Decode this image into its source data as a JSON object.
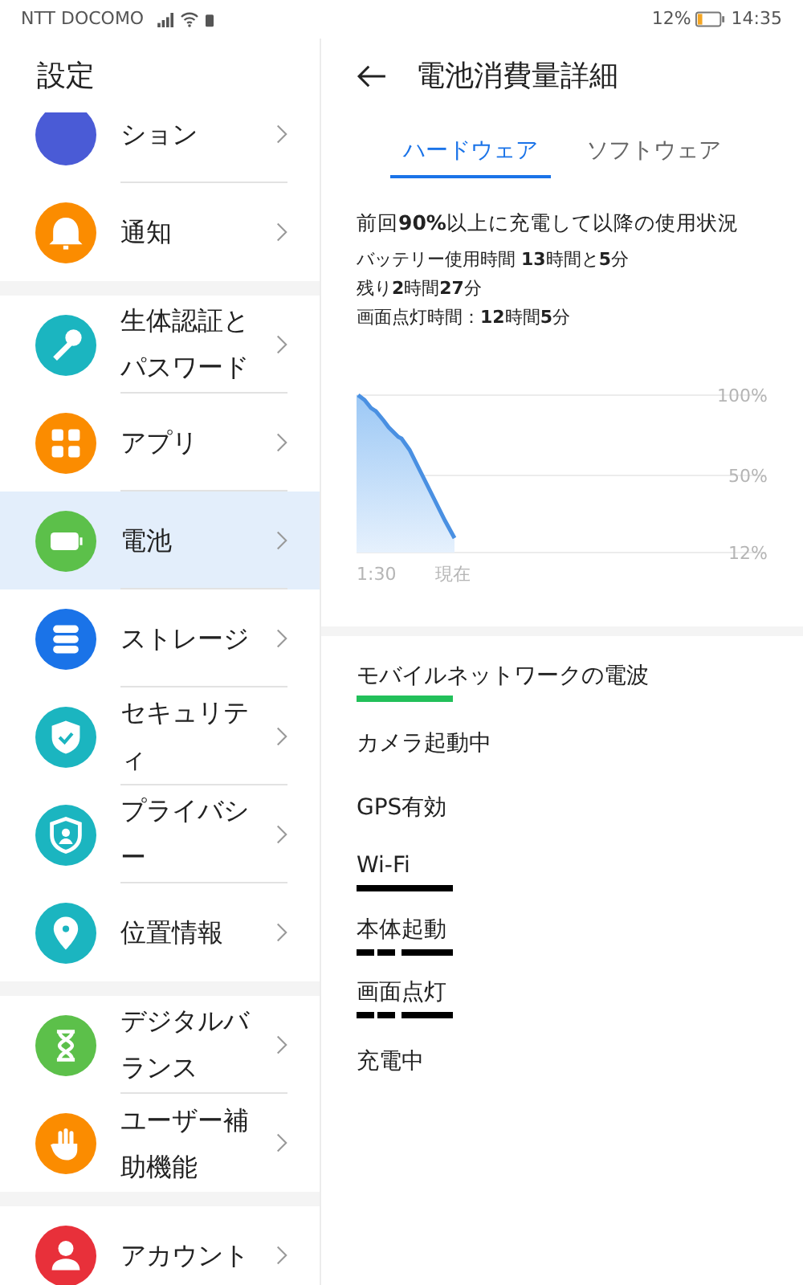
{
  "status_bar": {
    "carrier": "NTT DOCOMO",
    "battery": "12%",
    "time": "14:35"
  },
  "sidebar": {
    "title": "設定",
    "groups": [
      [
        {
          "label": "ション",
          "kind": "circle",
          "color": "#4a5bd6",
          "selected": false
        },
        {
          "label": "通知",
          "kind": "bell",
          "color": "#fb8c00",
          "selected": false
        }
      ],
      [
        {
          "label": "生体認証とパスワード",
          "kind": "key",
          "color": "#1bb5c0",
          "selected": false
        },
        {
          "label": "アプリ",
          "kind": "grid",
          "color": "#fb8c00",
          "selected": false
        },
        {
          "label": "電池",
          "kind": "battery",
          "color": "#5cc04a",
          "selected": true
        },
        {
          "label": "ストレージ",
          "kind": "storage",
          "color": "#1a73e8",
          "selected": false
        },
        {
          "label": "セキュリティ",
          "kind": "shield",
          "color": "#1bb5c0",
          "selected": false
        },
        {
          "label": "プライバシー",
          "kind": "privacy",
          "color": "#1bb5c0",
          "selected": false
        },
        {
          "label": "位置情報",
          "kind": "pin",
          "color": "#1bb5c0",
          "selected": false
        }
      ],
      [
        {
          "label": "デジタルバランス",
          "kind": "hourglass",
          "color": "#5cc04a",
          "selected": false
        },
        {
          "label": "ユーザー補助機能",
          "kind": "hand",
          "color": "#fb8c00",
          "selected": false
        }
      ],
      [
        {
          "label": "アカウント",
          "kind": "person",
          "color": "#e8303a",
          "selected": false
        }
      ]
    ]
  },
  "detail": {
    "title": "電池消費量詳細",
    "tabs": [
      {
        "label": "ハードウェア",
        "selected": true
      },
      {
        "label": "ソフトウェア",
        "selected": false
      }
    ],
    "summary_heading": "前回**90%**以上に充電して以降の使用状況",
    "summary_lines": [
      "バッテリー使用時間 **13**時間と**5**分",
      "残り**2**時間**27**分",
      "画面点灯時間：**12**時間**5**分"
    ],
    "chart": {
      "y_labels": [
        "100%",
        "50%",
        "12%"
      ],
      "x_labels": [
        "1:30",
        "現在"
      ]
    },
    "hardware": [
      {
        "label": "モバイルネットワークの電波",
        "kind": "full",
        "color": "#22c05a"
      },
      {
        "label": "カメラ起動中",
        "kind": "none"
      },
      {
        "label": "GPS有効",
        "kind": "none"
      },
      {
        "label": "Wi-Fi",
        "kind": "full",
        "color": "#000000"
      },
      {
        "label": "本体起動",
        "kind": "broken",
        "color": "#000000"
      },
      {
        "label": "画面点灯",
        "kind": "broken",
        "color": "#000000"
      },
      {
        "label": "充電中",
        "kind": "none"
      }
    ]
  }
}
